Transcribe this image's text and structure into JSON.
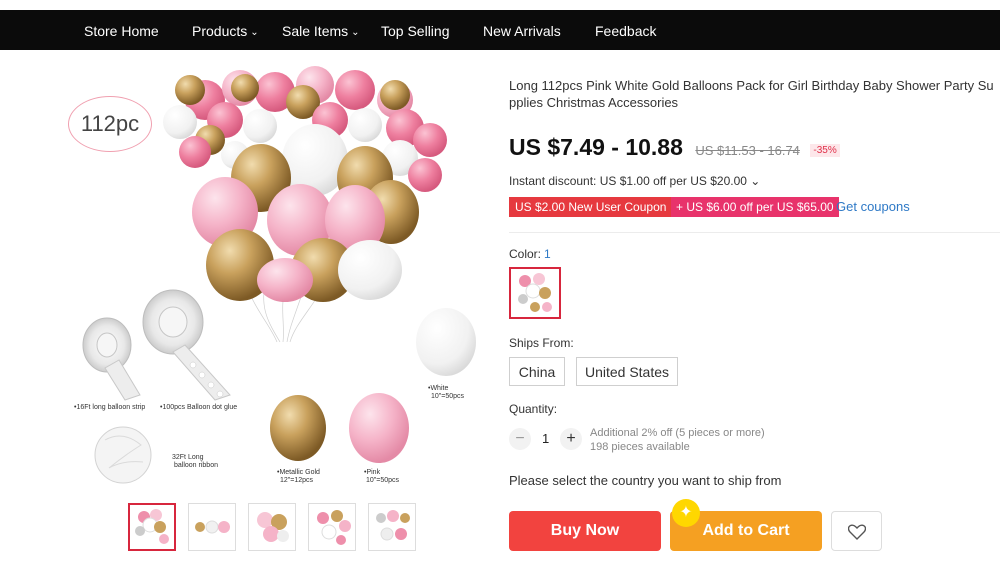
{
  "nav": {
    "items": [
      {
        "label": "Store Home",
        "has_dropdown": false
      },
      {
        "label": "Products",
        "has_dropdown": true
      },
      {
        "label": "Sale Items",
        "has_dropdown": true
      },
      {
        "label": "Top Selling",
        "has_dropdown": false
      },
      {
        "label": "New Arrivals",
        "has_dropdown": false
      },
      {
        "label": "Feedback",
        "has_dropdown": false
      }
    ],
    "chevron": "⌄"
  },
  "gallery": {
    "badge": "112pc",
    "captions": {
      "strip": "•16Ft long balloon strip",
      "glue": "•100pcs Balloon dot glue",
      "ribbon_1": "32Ft Long",
      "ribbon_2": "balloon ribbon",
      "white_1": "•White",
      "white_2": "10\"=50pcs",
      "gold_1": "•Metallic Gold",
      "gold_2": "12\"=12pcs",
      "pink_1": "•Pink",
      "pink_2": "10\"=50pcs"
    },
    "thumbnail_count": 5,
    "active_thumbnail": 1
  },
  "product": {
    "title_line1": "Long 112pcs Pink White Gold Balloons Pack for Girl Birthday Baby Shower Party Su",
    "title_line2": "pplies Christmas Accessories",
    "price": "US $7.49 - 10.88",
    "original_price": "US $11.53 - 16.74",
    "discount": "-35%",
    "instant_discount": "Instant discount: US $1.00 off per US $20.00 ⌄",
    "coupon_new_user": "US $2.00 New User Coupon",
    "coupon_store": "+ US $6.00 off per US $65.00",
    "get_coupons": "Get coupons",
    "color_label": "Color:",
    "color_count": "1",
    "ships_from_label": "Ships From:",
    "ships_from_options": [
      "China",
      "United States"
    ],
    "quantity_label": "Quantity:",
    "quantity_value": "1",
    "minus": "−",
    "plus": "+",
    "quantity_note_1": "Additional 2% off (5 pieces or more)",
    "quantity_note_2": "198 pieces available",
    "select_country": "Please select the country you want to ship from",
    "buy_now": "Buy Now",
    "add_to_cart": "Add to Cart",
    "spark": "✦"
  },
  "colors": {
    "nav_bg": "#0b0b0b",
    "accent_red": "#f2433f",
    "accent_orange": "#f5a022",
    "coupon_red": "#e6393f",
    "coupon_pink": "#e8336b",
    "link_blue": "#2e79c6"
  },
  "icons": {
    "wishlist": "heart-icon",
    "dropdown": "chevron-down-icon",
    "spark": "sparkle-icon"
  }
}
